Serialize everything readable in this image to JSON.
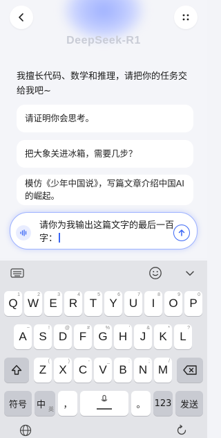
{
  "header": {
    "back_icon": "chevron-left-icon",
    "more_icon": "dots-grid-icon",
    "model_name": "DeepSeek-R1"
  },
  "chat": {
    "welcome": "我擅长代码、数学和推理，请把你的任务交给我吧~",
    "suggestions": [
      "请证明你会思考。",
      "把大象关进冰箱，需要几步？",
      "模仿《少年中国说》，写篇文章介绍中国AI的崛起。"
    ]
  },
  "composer": {
    "text": "请你为我输出这篇文字的最后一百字：",
    "voice_icon": "voice-wave-icon",
    "send_icon": "arrow-up-icon"
  },
  "keyboard": {
    "toolbar": {
      "left_icon": "keyboard-settings-icon",
      "emoji_icon": "emoji-icon",
      "collapse_icon": "chevron-down-icon"
    },
    "row1": [
      {
        "k": "Q",
        "s": "1"
      },
      {
        "k": "W",
        "s": "2"
      },
      {
        "k": "E",
        "s": "3"
      },
      {
        "k": "R",
        "s": "4"
      },
      {
        "k": "T",
        "s": "5"
      },
      {
        "k": "Y",
        "s": "6"
      },
      {
        "k": "U",
        "s": "7"
      },
      {
        "k": "I",
        "s": "8"
      },
      {
        "k": "O",
        "s": "9"
      },
      {
        "k": "P",
        "s": "0"
      }
    ],
    "row2": [
      {
        "k": "A",
        "s": "~"
      },
      {
        "k": "S",
        "s": "!"
      },
      {
        "k": "D",
        "s": "@"
      },
      {
        "k": "F",
        "s": "#"
      },
      {
        "k": "G",
        "s": "%"
      },
      {
        "k": "H",
        "s": "'"
      },
      {
        "k": "J",
        "s": "&"
      },
      {
        "k": "K",
        "s": "*"
      },
      {
        "k": "L",
        "s": "?"
      }
    ],
    "row3": [
      {
        "k": "Z",
        "s": "("
      },
      {
        "k": "X",
        "s": ")"
      },
      {
        "k": "C",
        "s": "-"
      },
      {
        "k": "V",
        "s": "_"
      },
      {
        "k": "B",
        "s": ":"
      },
      {
        "k": "N",
        "s": ";"
      },
      {
        "k": "M",
        "s": "/"
      }
    ],
    "shift_icon": "shift-icon",
    "delete_icon": "backspace-icon",
    "symbols_label": "符号",
    "lang_label": "中",
    "lang_sub": "英",
    "comma_label": "，",
    "period_label": "。",
    "mic_icon": "microphone-icon",
    "numbers_label": "123",
    "send_label": "发送",
    "globe_icon": "globe-icon",
    "refresh_icon": "refresh-icon"
  },
  "colors": {
    "accent": "#3a66f5",
    "glow": "#9fb1ff",
    "chat_bg": "#f4f5f9",
    "keyboard_bg": "#e3e4e8"
  }
}
